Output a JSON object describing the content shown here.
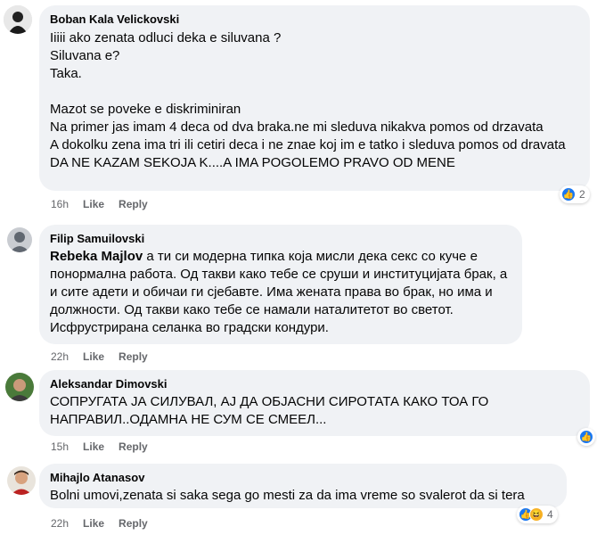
{
  "comments": [
    {
      "author": "Boban Kala Velickovski",
      "text": "Iiiii ako zenata odluci deka e siluvana ?\nSiluvana e?\nTaka.\n\nMazot se poveke e diskriminiran\nNa primer jas imam 4 deca od dva braka.ne mi sleduva nikakva pomos od drzavata\nA dokolku zena ima tri ili cetiri deca i ne znae koj im e tatko i sleduva pomos od dravata\nDA NE KAZAM SEKOJA K....A IMA POGOLEMO PRAVO OD MENE",
      "time": "16h",
      "like": "Like",
      "reply": "Reply",
      "reactions": "2",
      "icons": [
        "like-icon"
      ]
    },
    {
      "author": "Filip Samuilovski",
      "mention": "Rebeka Majlov",
      "text": " а ти си модерна типка која мисли дека секс со куче е понормална работа. Од такви како тебе се сруши и институцијата брак, а и сите адети и обичаи ги сјебавте. Има жената права во брак, но има и должности. Од такви како тебе се намали наталитетот во светот. Исфрустрирана селанка во градски кондури.",
      "time": "22h",
      "like": "Like",
      "reply": "Reply"
    },
    {
      "author": "Aleksandar Dimovski",
      "text": "СОПРУГАТА ЈА СИЛУВАЛ, АЈ ДА ОБЈАСНИ СИРОТАТА КАКО ТОА ГО НАПРАВИЛ..ОДАМНА НЕ СУМ СЕ СМЕЕЛ...",
      "time": "15h",
      "like": "Like",
      "reply": "Reply",
      "icons": [
        "like-icon"
      ]
    },
    {
      "author": "Mihajlo Atanasov",
      "text": "Bolni umovi,zenata si saka sega go mesti za da ima vreme so svalerot da si tera",
      "time": "22h",
      "like": "Like",
      "reply": "Reply",
      "reactions": "4",
      "icons": [
        "like-icon",
        "haha-icon"
      ]
    }
  ],
  "colors": {
    "bubble": "#f0f2f5",
    "meta": "#65676b",
    "like": "#1877f2",
    "haha": "#f7b125"
  }
}
